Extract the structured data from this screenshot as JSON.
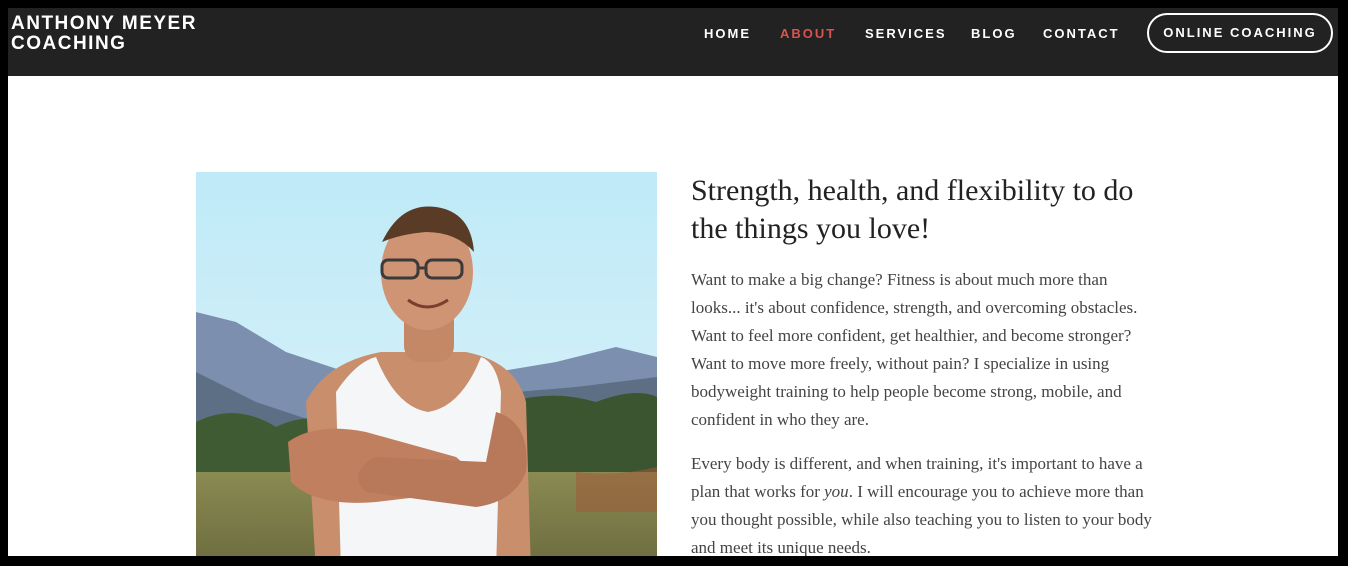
{
  "site": {
    "logo_line1": "ANTHONY MEYER",
    "logo_line2": "COACHING"
  },
  "nav": {
    "home": "HOME",
    "about": "ABOUT",
    "services": "SERVICES",
    "blog": "BLOG",
    "contact": "CONTACT",
    "cta": "ONLINE COACHING",
    "active_item": "ABOUT",
    "active_color": "#d9534f"
  },
  "about": {
    "headline": "Strength, health, and flexibility to do the things you love!",
    "paragraph1": "Want to make a big change? Fitness is about much more than looks... it's about confidence, strength, and overcoming obstacles. Want to feel more confident, get healthier, and become stronger? Want to move more freely, without pain? I specialize in using bodyweight training to help people become strong, mobile, and confident in who they are.",
    "paragraph2_before": "Every body is different, and when training, it's important to have a plan that works for ",
    "paragraph2_emphasis": "you",
    "paragraph2_after": ". I will encourage you to achieve more than you thought possible, while also teaching you to listen to your body and meet its unique needs."
  },
  "colors": {
    "header_bg": "#222222",
    "page_bg": "#ffffff",
    "accent": "#d9534f"
  }
}
